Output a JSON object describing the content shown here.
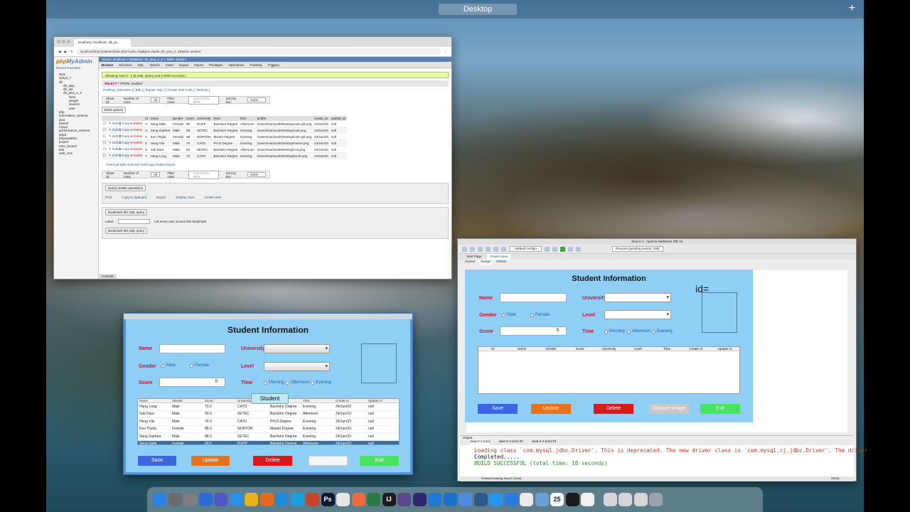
{
  "desktop": {
    "title": "Desktop",
    "plus": "+"
  },
  "browser": {
    "tab_label": "localhost / localhost / db_ja...",
    "url": "localhost/phpmyadmin/index.php?route=/sql&pos=0&db=db_java_2_4&table=student",
    "logo_php": "php",
    "logo_myadmin": "MyAdmin",
    "side_links": "Recent  Favorites",
    "tree": [
      "New",
      "2yhyd_7",
      "db",
      "db_ajax",
      "db_api",
      "db_java_2_4",
      "New",
      "people",
      "student",
      "user",
      "php",
      "information_schema",
      "java",
      "laravel",
      "mysql",
      "performance_schema",
      "phpd",
      "phpmyadmin",
      "project",
      "reen_laravel",
      "test",
      "web_cms"
    ],
    "breadcrumb": "Server: localhost » Database: db_java_2_4 » Table: student",
    "tabs": [
      "Browse",
      "Structure",
      "SQL",
      "Search",
      "Insert",
      "Export",
      "Import",
      "Privileges",
      "Operations",
      "Tracking",
      "Triggers"
    ],
    "success_msg": "Showing rows 0 - 5 (6 total, Query took 0.0002 seconds.)",
    "sql_select": "SELECT",
    "sql_rest": " * FROM `student`",
    "query_links": "Profiling [ Edit inline ] [ Edit ] [ Explain SQL ] [ Create PHP code ] [ Refresh ]",
    "filter_show_all": "Show all",
    "filter_rows": "Number of rows:",
    "filter_rows_val": "25",
    "filter_filter": "Filter rows:",
    "filter_search": "Search this table",
    "filter_sort": "Sort by key:",
    "filter_sort_val": "None",
    "extra_options": "Extra options",
    "columns": [
      "id",
      "name",
      "gender",
      "score",
      "university",
      "level",
      "time",
      "profile",
      "create_at",
      "update_at"
    ],
    "rows": [
      [
        "2",
        "Seng Dalin",
        "Female",
        "90",
        "RUPP",
        "Bachelor Degree",
        "Afternoon",
        "/Users/macbook/Desktop/cute-girl.png",
        "24/Jun/23",
        "null"
      ],
      [
        "3",
        "Seng Sophea",
        "Male",
        "88",
        "SETEC",
        "Bachelor Degree",
        "Evening",
        "/Users/macbook/Desktop/cute.png",
        "24/Jun/23",
        "null"
      ],
      [
        "4",
        "Keo Thyda",
        "Female",
        "88",
        "NORTON",
        "Master Degree",
        "Evening",
        "/Users/macbook/Desktop/cute-girl.png",
        "24/Jun/23",
        "null"
      ],
      [
        "5",
        "Heng Vilu",
        "Male",
        "70",
        "CATO",
        "PH.D Degree",
        "Evening",
        "/Users/macbook/Desktop/meme.png",
        "24/Jun/23",
        "null"
      ],
      [
        "6",
        "Sok Dara",
        "Male",
        "50",
        "SETEC",
        "Bachelor Degree",
        "Afternoon",
        "/Users/macbook/Desktop/cca.png",
        "24/Jun/23",
        "null"
      ],
      [
        "7",
        "Hang Long",
        "Male",
        "70",
        "CATO",
        "Bachelor Degree",
        "Evening",
        "/Users/macbook/Desktop/tooth.png",
        "24/Jun/23",
        "null"
      ]
    ],
    "row_actions": {
      "edit": "Edit",
      "copy": "Copy",
      "delete": "Delete"
    },
    "with_selected": "Check all    With selected:    Edit    Copy    Delete    Export",
    "qro_title": "Query results operations",
    "qro_links": [
      "Print",
      "Copy to clipboard",
      "Export",
      "Display chart",
      "Create view"
    ],
    "bookmark_title": "Bookmark this SQL query",
    "bookmark_label": "Label:",
    "bookmark_check": "Let every user access this bookmark",
    "bookmark_btn": "Bookmark this SQL query",
    "console": "Console"
  },
  "swing": {
    "title": "Student Information",
    "labels": {
      "name": "Name",
      "gender": "Gender",
      "score": "Score",
      "university": "University",
      "level": "Level",
      "time": "Time"
    },
    "gender_options": [
      "Male",
      "Female"
    ],
    "time_options": [
      "Morning",
      "Afternoon",
      "Evening"
    ],
    "score_value": "0",
    "tooltip": "Student",
    "table_headers": [
      "Name",
      "Gender",
      "Score",
      "University",
      "Level",
      "Time",
      "Create At",
      "Update At"
    ],
    "table_rows": [
      [
        "Hang Long",
        "Male",
        "70.0",
        "CATO",
        "Bachelor Degree",
        "Evening",
        "24/Jun/23",
        "null"
      ],
      [
        "Sok Dara",
        "Male",
        "50.0",
        "SETEC",
        "Bachelor Degree",
        "Afternoon",
        "24/Jun/23",
        "null"
      ],
      [
        "Heng Vilu",
        "Male",
        "70.0",
        "CATO",
        "PH.D Degree",
        "Evening",
        "24/Jun/23",
        "null"
      ],
      [
        "Keo Thyda",
        "Female",
        "88.0",
        "NORTON",
        "Master Degree",
        "Evening",
        "24/Jun/23",
        "null"
      ],
      [
        "Seng Sophea",
        "Male",
        "88.0",
        "SETEC",
        "Bachelor Degree",
        "Evening",
        "24/Jun/23",
        "null"
      ],
      [
        "Seng Dalin",
        "Female",
        "90.0",
        "RUPP",
        "Bachelor Degree",
        "Afternoon",
        "24/Jun/23",
        "null"
      ]
    ],
    "buttons": {
      "save": "Save",
      "update": "Update",
      "delete": "Delete",
      "choose": "",
      "exit": "Exit"
    }
  },
  "netbeans": {
    "title": "Java-2-4 - Apache NetBeans IDE 16",
    "config": "<default config>",
    "resume": "Resume (pending events: 196)",
    "editor_tabs": [
      "Start Page",
      "Student.java"
    ],
    "sub_tabs": [
      "Source",
      "Design",
      "History"
    ],
    "form_title": "Student Information",
    "id_label": "id=",
    "labels": {
      "name": "Name",
      "gender": "Gender",
      "score": "Score",
      "university": "University",
      "level": "Level",
      "time": "Time"
    },
    "gender_options": [
      "Male",
      "Female"
    ],
    "time_options": [
      "Morning",
      "Afternoon",
      "Evening"
    ],
    "score_value": "0",
    "table_headers": [
      "ID",
      "Name",
      "Gender",
      "Score",
      "University",
      "Level",
      "Time",
      "Create At",
      "Update At"
    ],
    "buttons": {
      "save": "Save",
      "update": "Update",
      "delete": "Delete",
      "choose": "Choose Image",
      "exit": "Exit"
    },
    "output_title": "Output",
    "output_tabs": [
      "Java-2-4 (run)",
      "Java-2-4 (run) #2",
      "Java-2-4 (run) #3"
    ],
    "output_lines": [
      "Loading class `com.mysql.jdbc.Driver'. This is deprecated. The new driver class is `com.mysql.cj.jdbc.Driver'. The driver",
      "Completed.....",
      "BUILD SUCCESSFUL (total time: 18 seconds)"
    ],
    "status": "Finished building Java-2-4 (run).",
    "cursor_pos": "378:61"
  },
  "dock": {
    "apps": [
      {
        "name": "finder-icon",
        "color": "#2a82e0",
        "glyph": ""
      },
      {
        "name": "launchpad-icon",
        "color": "#6b6b6b",
        "glyph": ""
      },
      {
        "name": "settings-icon",
        "color": "#7d7d7d",
        "glyph": ""
      },
      {
        "name": "xcode-icon",
        "color": "#2b6bd6",
        "glyph": ""
      },
      {
        "name": "teams-icon",
        "color": "#5058c8",
        "glyph": ""
      },
      {
        "name": "safari-icon",
        "color": "#2d8ee6",
        "glyph": ""
      },
      {
        "name": "chrome-icon",
        "color": "#e8b21b",
        "glyph": ""
      },
      {
        "name": "firefox-icon",
        "color": "#e56a1d",
        "glyph": ""
      },
      {
        "name": "edge-icon",
        "color": "#1e8ad8",
        "glyph": ""
      },
      {
        "name": "skype-icon",
        "color": "#1a9fe0",
        "glyph": ""
      },
      {
        "name": "powerpoint-icon",
        "color": "#c9432a",
        "glyph": ""
      },
      {
        "name": "photoshop-icon",
        "color": "#0a1a33",
        "glyph": "Ps"
      },
      {
        "name": "wordpress-icon",
        "color": "#e6e6e6",
        "glyph": ""
      },
      {
        "name": "swift-icon",
        "color": "#ee6a3d",
        "glyph": ""
      },
      {
        "name": "android-studio-icon",
        "color": "#2b7a44",
        "glyph": ""
      },
      {
        "name": "intellij-icon",
        "color": "#1c1c1c",
        "glyph": "IJ"
      },
      {
        "name": "netbeans-icon",
        "color": "#5a4a8c",
        "glyph": ""
      },
      {
        "name": "eclipse-icon",
        "color": "#2c2a6a",
        "glyph": ""
      },
      {
        "name": "vscode-icon",
        "color": "#1f7bd1",
        "glyph": ""
      },
      {
        "name": "xampp-icon",
        "color": "#1a6fc9",
        "glyph": ""
      },
      {
        "name": "mail-icon",
        "color": "#4a8de0",
        "glyph": ""
      },
      {
        "name": "mysql-workbench-icon",
        "color": "#2c5a8c",
        "glyph": ""
      },
      {
        "name": "docker-icon",
        "color": "#2496ed",
        "glyph": ""
      },
      {
        "name": "app-store-icon",
        "color": "#2a7ae2",
        "glyph": ""
      },
      {
        "name": "photos-icon",
        "color": "#e9e9e9",
        "glyph": ""
      },
      {
        "name": "preview-icon",
        "color": "#6aa0d8",
        "glyph": ""
      },
      {
        "name": "calendar-icon",
        "color": "#f5f5f5",
        "glyph": "25"
      },
      {
        "name": "terminal-icon",
        "color": "#1b1b1b",
        "glyph": ""
      },
      {
        "name": "java-icon",
        "color": "#f0f0f0",
        "glyph": ""
      },
      {
        "name": "screenshot-1-icon",
        "color": "#d6d6d6",
        "glyph": ""
      },
      {
        "name": "screenshot-2-icon",
        "color": "#d6d6d6",
        "glyph": ""
      },
      {
        "name": "screenshot-3-icon",
        "color": "#d6d6d6",
        "glyph": ""
      },
      {
        "name": "trash-icon",
        "color": "#9aa3ab",
        "glyph": ""
      }
    ]
  }
}
